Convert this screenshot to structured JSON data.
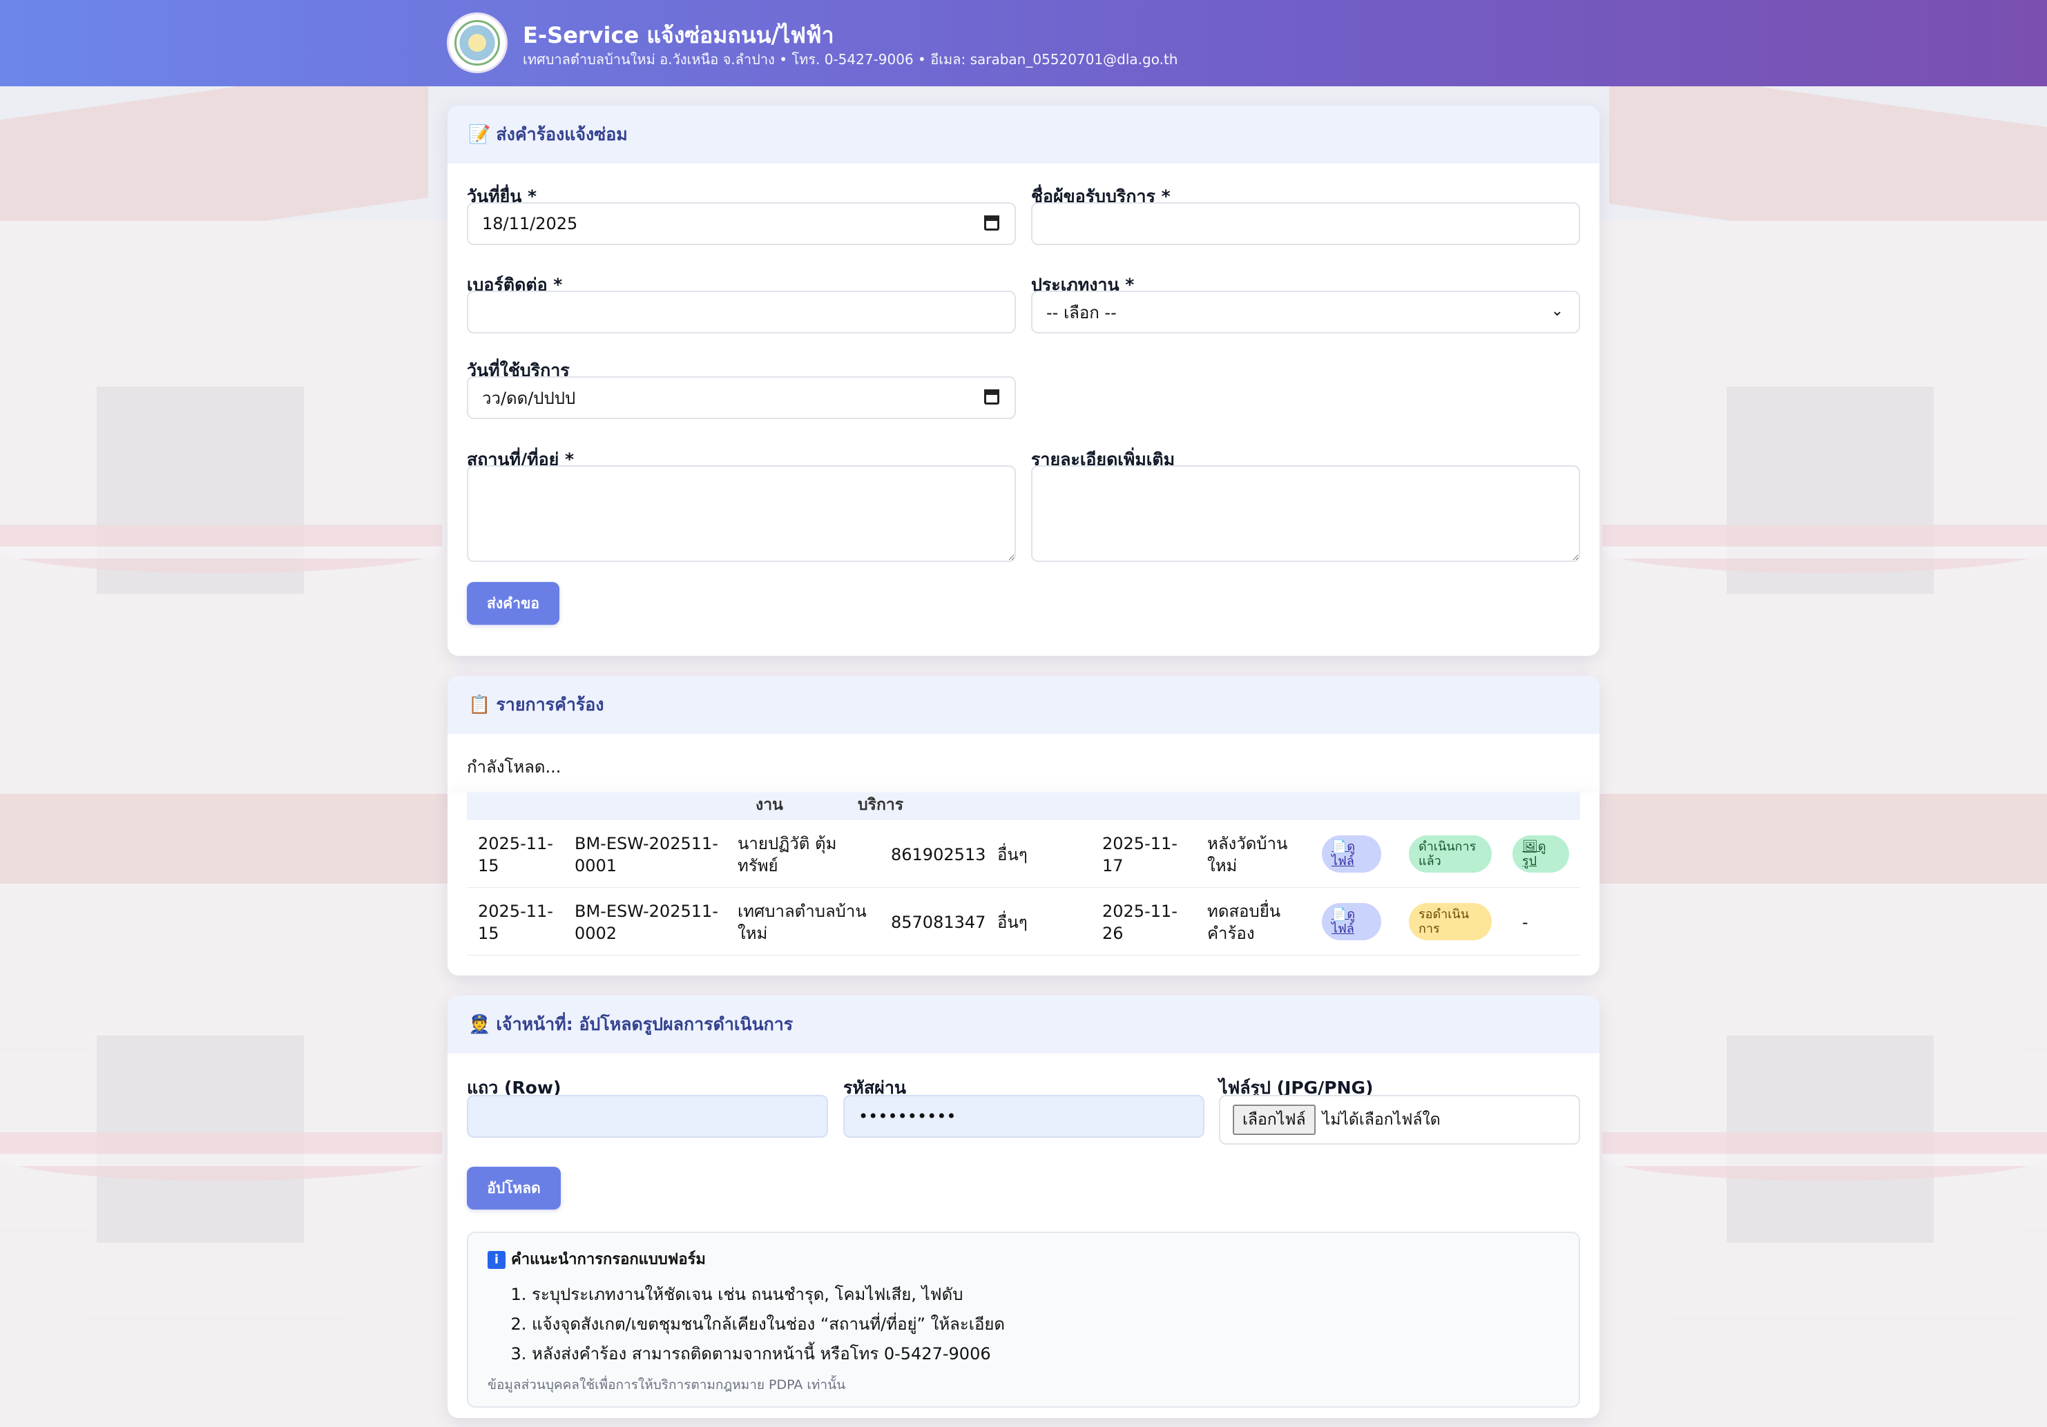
{
  "header": {
    "title": "E-Service แจ้งซ่อมถนน/ไฟฟ้า",
    "subtitle": "เทศบาลตำบลบ้านใหม่ อ.วังเหนือ จ.ลำปาง • โทร. 0-5427-9006 • อีเมล: saraban_05520701@dla.go.th"
  },
  "form": {
    "title": "ส่งคำร้องแจ้งซ่อม",
    "date_label": "วันที่ยื่น *",
    "date_value": "18/11/2025",
    "name_label": "ชื่อผู้ขอรับบริการ *",
    "phone_label": "เบอร์ติดต่อ *",
    "type_label": "ประเภทงาน *",
    "type_value": "-- เลือก --",
    "service_date_label": "วันที่ใช้บริการ",
    "service_date_placeholder": "วว/ดด/ปปปป",
    "address_label": "สถานที่/ที่อยู่ *",
    "details_label": "รายละเอียดเพิ่มเติม",
    "submit_label": "ส่งคำขอ"
  },
  "requests": {
    "title": "รายการคำร้อง",
    "loading": "กำลังโหลด...",
    "header_fragments": [
      "งาน",
      "บริการ"
    ],
    "rows": [
      {
        "date": "2025-11-15",
        "id": "BM-ESW-202511-0001",
        "name": "นายปฏิวัติ ตุ้มทรัพย์",
        "phone": "861902513",
        "type": "อื่นๆ",
        "service_date": "2025-11-17",
        "place": "หลังวัดบ้านใหม่",
        "file": "📄ดูไฟล์",
        "status": "ดำเนินการแล้ว",
        "status_kind": "done",
        "image": "🖼ดูรูป"
      },
      {
        "date": "2025-11-15",
        "id": "BM-ESW-202511-0002",
        "name": "เทศบาลตำบลบ้านใหม่",
        "phone": "857081347",
        "type": "อื่นๆ",
        "service_date": "2025-11-26",
        "place": "ทดสอบยื่นคำร้อง",
        "file": "📄ดูไฟล์",
        "status": "รอดำเนินการ",
        "status_kind": "wait",
        "image": "-"
      }
    ]
  },
  "upload": {
    "title": "เจ้าหน้าที่: อัปโหลดรูปผลการดำเนินการ",
    "row_label": "แถว (Row)",
    "password_label": "รหัสผ่าน",
    "password_value": "••••••••••",
    "file_label": "ไฟล์รูป (JPG/PNG)",
    "file_button": "เลือกไฟล์",
    "file_none": "ไม่ได้เลือกไฟล์ใด",
    "upload_label": "อัปโหลด"
  },
  "info": {
    "badge": "i",
    "title": "คำแนะนำการกรอกแบบฟอร์ม",
    "items": [
      "ระบุประเภทงานให้ชัดเจน เช่น ถนนชำรุด, โคมไฟเสีย, ไฟดับ",
      "แจ้งจุดสังเกต/เขตชุมชนใกล้เคียงในช่อง “สถานที่/ที่อยู่” ให้ละเอียด",
      "หลังส่งคำร้อง สามารถติดตามจากหน้านี้ หรือโทร 0-5427-9006"
    ],
    "note": "ข้อมูลส่วนบุคคลใช้เพื่อการให้บริการตามกฎหมาย PDPA เท่านั้น"
  },
  "icons": {
    "form": "memo-icon",
    "requests": "clipboard-icon",
    "upload": "officer-icon",
    "info": "info-icon",
    "calendar": "calendar-icon"
  },
  "colors": {
    "header_start": "#6d86ea",
    "header_end": "#7a4fb0",
    "button": "#6a7fe6",
    "card_head": "#eef2fd",
    "status_done": "#b7efd0",
    "status_wait": "#fde59a"
  }
}
